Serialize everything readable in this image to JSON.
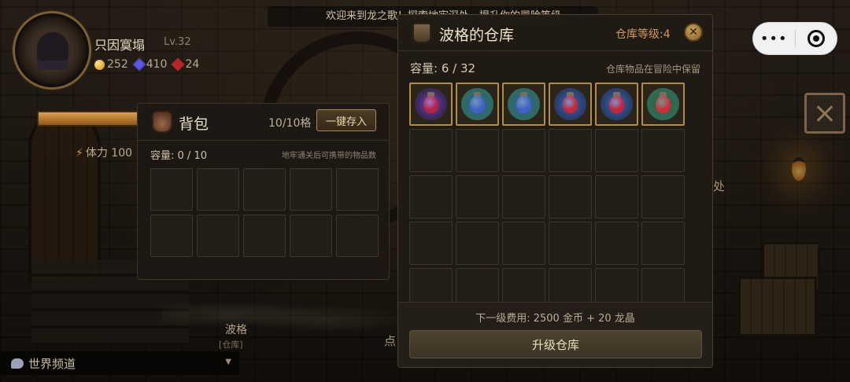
{
  "top": {
    "marquee": "欢迎来到龙之歌！探索地牢深处，提升你的冒险等级",
    "more_icon": "•••",
    "capsule_close_icon": "target-close"
  },
  "player": {
    "name": "只因寞塌",
    "level": "Lv.32",
    "gold": "252",
    "gems": "410",
    "rubies": "24",
    "stamina": "体力 100"
  },
  "scene": {
    "npc_name": "波格",
    "npc_sub": "[仓库]",
    "point_label": "点",
    "side_char": "处"
  },
  "world_chat": {
    "label": "世界频道",
    "arrow": "▼"
  },
  "backpack": {
    "title": "背包",
    "count": "10/10格",
    "deposit_all": "一键存入",
    "capacity": "容量: 0 / 10",
    "hint": "地牢通关后可携带的物品数",
    "slots": 10
  },
  "warehouse": {
    "title": "波格的仓库",
    "level": "仓库等级:4",
    "capacity": "容量: 6 / 32",
    "hint": "仓库物品在冒险中保留",
    "next_cost": "下一级费用: 2500 金币 + 20 龙晶",
    "upgrade": "升级仓库",
    "items": [
      {
        "name": "purple-demon-orb-icon",
        "ring": "#3a2a55",
        "glow": "#7a3cd0",
        "core": "#b52244"
      },
      {
        "name": "blue-mana-potion-icon",
        "ring": "#2f6b62",
        "glow": "#2d5ea8",
        "core": "#3e62c8"
      },
      {
        "name": "blue-mana-potion-icon",
        "ring": "#2f6b62",
        "glow": "#2d5ea8",
        "core": "#3e62c8"
      },
      {
        "name": "red-health-potion-icon",
        "ring": "#2a3e6a",
        "glow": "#3b69c6",
        "core": "#c8243a"
      },
      {
        "name": "red-health-potion-icon",
        "ring": "#2a3e6a",
        "glow": "#3b69c6",
        "core": "#c8243a"
      },
      {
        "name": "red-elixir-icon",
        "ring": "#2f6b52",
        "glow": "#2d6048",
        "core": "#d22b3c"
      }
    ],
    "total_slots": 36
  },
  "colors": {
    "accent_gold": "#b08c45",
    "level_orange": "#d29b55"
  }
}
